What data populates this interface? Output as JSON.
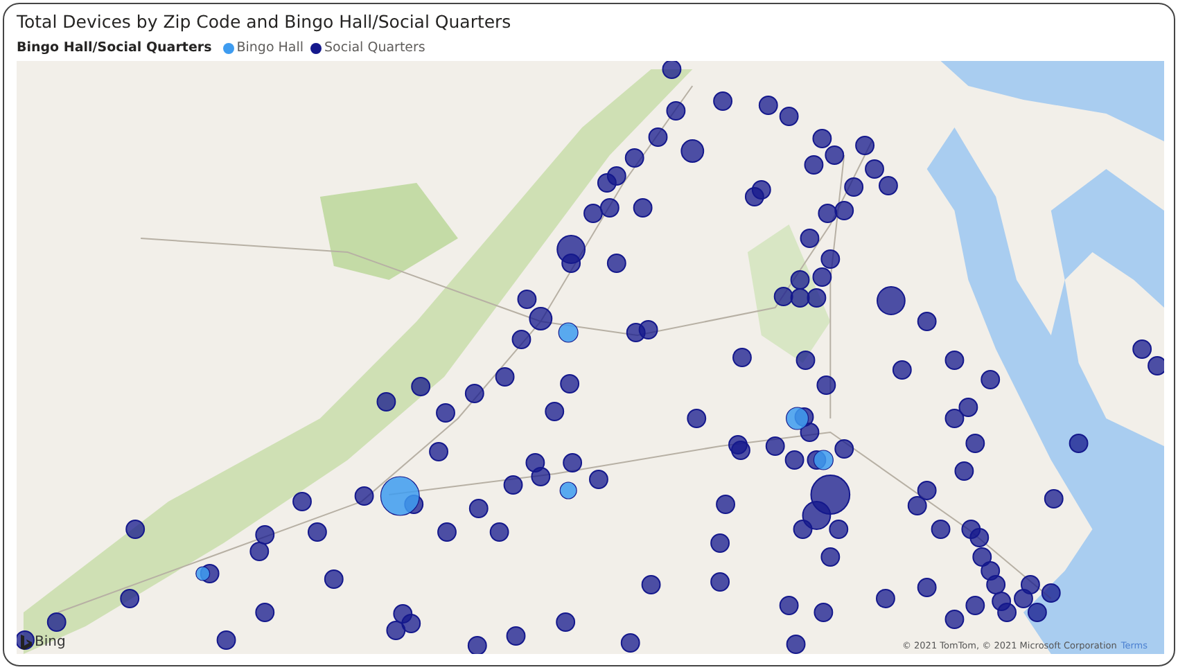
{
  "title": "Total Devices by Zip Code and Bingo Hall/Social Quarters",
  "legend": {
    "title": "Bingo Hall/Social Quarters",
    "items": [
      {
        "label": "Bingo Hall",
        "color": "#3e9cf0"
      },
      {
        "label": "Social Quarters",
        "color": "#14188c"
      }
    ]
  },
  "map": {
    "logo": "Bing",
    "attribution": "© 2021 TomTom, © 2021 Microsoft Corporation",
    "terms_link": "Terms"
  }
}
